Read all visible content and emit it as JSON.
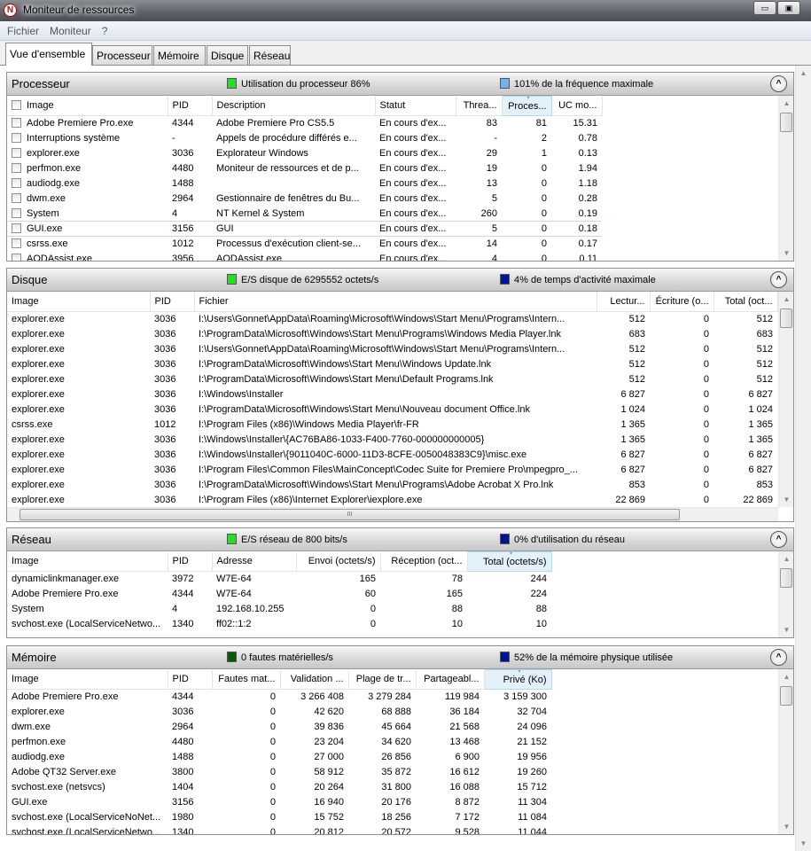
{
  "window": {
    "title": "Moniteur de ressources",
    "app_icon": "resource-monitor-icon",
    "minimize": "▭",
    "maximize": "▣"
  },
  "menu": [
    "Fichier",
    "Moniteur",
    "?"
  ],
  "tabs": [
    "Vue d'ensemble",
    "Processeur",
    "Mémoire",
    "Disque",
    "Réseau"
  ],
  "active_tab": 0,
  "colors": {
    "green": "#20e020",
    "light_blue": "#6fb4f2",
    "dark_blue": "#0010a0",
    "dark_green": "#0a5a0a"
  },
  "sections": {
    "cpu": {
      "title": "Processeur",
      "ind1": "Utilisation du processeur 86%",
      "ind2": "101% de la fréquence maximale",
      "columns": [
        "Image",
        "PID",
        "Description",
        "Statut",
        "Threa...",
        "Proces...",
        "UC mo..."
      ],
      "sorted": 5,
      "right": [
        4,
        5,
        6
      ],
      "rows": [
        [
          "Adobe Premiere Pro.exe",
          "4344",
          "Adobe Premiere Pro CS5.5",
          "En cours d'ex...",
          "83",
          "81",
          "15.31"
        ],
        [
          "Interruptions système",
          "-",
          "Appels de procédure différés e...",
          "En cours d'ex...",
          "-",
          "2",
          "0.78"
        ],
        [
          "explorer.exe",
          "3036",
          "Explorateur Windows",
          "En cours d'ex...",
          "29",
          "1",
          "0.13"
        ],
        [
          "perfmon.exe",
          "4480",
          "Moniteur de ressources et de p...",
          "En cours d'ex...",
          "19",
          "0",
          "1.94"
        ],
        [
          "audiodg.exe",
          "1488",
          "",
          "En cours d'ex...",
          "13",
          "0",
          "1.18"
        ],
        [
          "dwm.exe",
          "2964",
          "Gestionnaire de fenêtres du Bu...",
          "En cours d'ex...",
          "5",
          "0",
          "0.28"
        ],
        [
          "System",
          "4",
          "NT Kernel & System",
          "En cours d'ex...",
          "260",
          "0",
          "0.19"
        ],
        [
          "GUI.exe",
          "3156",
          "GUI",
          "En cours d'ex...",
          "5",
          "0",
          "0.18"
        ],
        [
          "csrss.exe",
          "1012",
          "Processus d'exécution client-se...",
          "En cours d'ex...",
          "14",
          "0",
          "0.17"
        ],
        [
          "AODAssist.exe",
          "3956",
          "AODAssist.exe",
          "En cours d'ex...",
          "4",
          "0",
          "0.11"
        ]
      ],
      "highlight": 7
    },
    "disk": {
      "title": "Disque",
      "ind1": "E/S disque de 6295552 octets/s",
      "ind2": "4% de temps d'activité maximale",
      "columns": [
        "Image",
        "PID",
        "Fichier",
        "Lectur...",
        "Écriture (o...",
        "Total (oct..."
      ],
      "sorted": -1,
      "right": [
        3,
        4,
        5
      ],
      "rows": [
        [
          "explorer.exe",
          "3036",
          "I:\\Users\\Gonnet\\AppData\\Roaming\\Microsoft\\Windows\\Start Menu\\Programs\\Intern...",
          "512",
          "0",
          "512"
        ],
        [
          "explorer.exe",
          "3036",
          "I:\\ProgramData\\Microsoft\\Windows\\Start Menu\\Programs\\Windows Media Player.lnk",
          "683",
          "0",
          "683"
        ],
        [
          "explorer.exe",
          "3036",
          "I:\\Users\\Gonnet\\AppData\\Roaming\\Microsoft\\Windows\\Start Menu\\Programs\\Intern...",
          "512",
          "0",
          "512"
        ],
        [
          "explorer.exe",
          "3036",
          "I:\\ProgramData\\Microsoft\\Windows\\Start Menu\\Windows Update.lnk",
          "512",
          "0",
          "512"
        ],
        [
          "explorer.exe",
          "3036",
          "I:\\ProgramData\\Microsoft\\Windows\\Start Menu\\Default Programs.lnk",
          "512",
          "0",
          "512"
        ],
        [
          "explorer.exe",
          "3036",
          "I:\\Windows\\Installer",
          "6 827",
          "0",
          "6 827"
        ],
        [
          "explorer.exe",
          "3036",
          "I:\\ProgramData\\Microsoft\\Windows\\Start Menu\\Nouveau document Office.lnk",
          "1 024",
          "0",
          "1 024"
        ],
        [
          "csrss.exe",
          "1012",
          "I:\\Program Files (x86)\\Windows Media Player\\fr-FR",
          "1 365",
          "0",
          "1 365"
        ],
        [
          "explorer.exe",
          "3036",
          "I:\\Windows\\Installer\\{AC76BA86-1033-F400-7760-000000000005}",
          "1 365",
          "0",
          "1 365"
        ],
        [
          "explorer.exe",
          "3036",
          "I:\\Windows\\Installer\\{9011040C-6000-11D3-8CFE-0050048383C9}\\misc.exe",
          "6 827",
          "0",
          "6 827"
        ],
        [
          "explorer.exe",
          "3036",
          "I:\\Program Files\\Common Files\\MainConcept\\Codec Suite for Premiere Pro\\mpegpro_...",
          "6 827",
          "0",
          "6 827"
        ],
        [
          "explorer.exe",
          "3036",
          "I:\\ProgramData\\Microsoft\\Windows\\Start Menu\\Programs\\Adobe Acrobat X Pro.lnk",
          "853",
          "0",
          "853"
        ],
        [
          "explorer.exe",
          "3036",
          "I:\\Program Files (x86)\\Internet Explorer\\iexplore.exe",
          "22 869",
          "0",
          "22 869"
        ]
      ],
      "hscroll_grip": "III"
    },
    "net": {
      "title": "Réseau",
      "ind1": "E/S réseau de 800 bits/s",
      "ind2": "0% d'utilisation du réseau",
      "columns": [
        "Image",
        "PID",
        "Adresse",
        "Envoi (octets/s)",
        "Réception (oct...",
        "Total (octets/s)"
      ],
      "sorted": 5,
      "right": [
        3,
        4,
        5
      ],
      "rows": [
        [
          "dynamiclinkmanager.exe",
          "3972",
          "W7E-64",
          "165",
          "78",
          "244"
        ],
        [
          "Adobe Premiere Pro.exe",
          "4344",
          "W7E-64",
          "60",
          "165",
          "224"
        ],
        [
          "System",
          "4",
          "192.168.10.255",
          "0",
          "88",
          "88"
        ],
        [
          "svchost.exe (LocalServiceNetwo...",
          "1340",
          "ff02::1:2",
          "0",
          "10",
          "10"
        ]
      ]
    },
    "mem": {
      "title": "Mémoire",
      "ind1": "0 fautes matérielles/s",
      "ind2": "52% de la mémoire physique utilisée",
      "columns": [
        "Image",
        "PID",
        "Fautes mat...",
        "Validation ...",
        "Plage de tr...",
        "Partageabl...",
        "Privé (Ko)"
      ],
      "sorted": 6,
      "right": [
        2,
        3,
        4,
        5,
        6
      ],
      "rows": [
        [
          "Adobe Premiere Pro.exe",
          "4344",
          "0",
          "3 266 408",
          "3 279 284",
          "119 984",
          "3 159 300"
        ],
        [
          "explorer.exe",
          "3036",
          "0",
          "42 620",
          "68 888",
          "36 184",
          "32 704"
        ],
        [
          "dwm.exe",
          "2964",
          "0",
          "39 836",
          "45 664",
          "21 568",
          "24 096"
        ],
        [
          "perfmon.exe",
          "4480",
          "0",
          "23 204",
          "34 620",
          "13 468",
          "21 152"
        ],
        [
          "audiodg.exe",
          "1488",
          "0",
          "27 000",
          "26 856",
          "6 900",
          "19 956"
        ],
        [
          "Adobe QT32 Server.exe",
          "3800",
          "0",
          "58 912",
          "35 872",
          "16 612",
          "19 260"
        ],
        [
          "svchost.exe (netsvcs)",
          "1404",
          "0",
          "20 264",
          "31 800",
          "16 088",
          "15 712"
        ],
        [
          "GUI.exe",
          "3156",
          "0",
          "16 940",
          "20 176",
          "8 872",
          "11 304"
        ],
        [
          "svchost.exe (LocalServiceNoNet...",
          "1980",
          "0",
          "15 752",
          "18 256",
          "7 172",
          "11 084"
        ],
        [
          "svchost.exe (LocalServiceNetwo...",
          "1340",
          "0",
          "20 812",
          "20 572",
          "9 528",
          "11 044"
        ]
      ]
    }
  }
}
